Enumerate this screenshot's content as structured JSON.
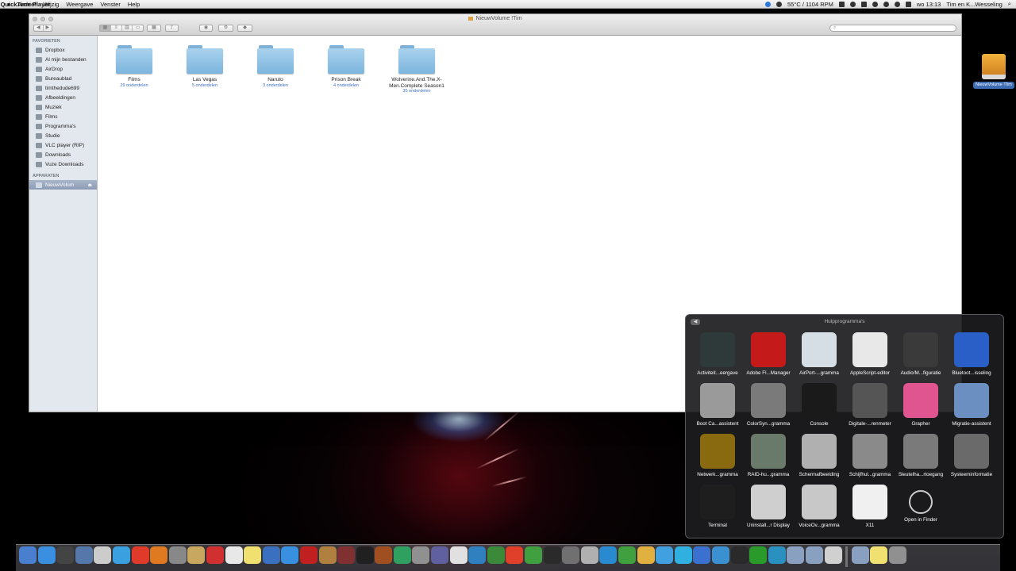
{
  "menubar": {
    "app_name": "QuickTime Player",
    "menus": [
      "Archief",
      "Wijzig",
      "Weergave",
      "Venster",
      "Help"
    ],
    "weather": "55°C / 1104 RPM",
    "clock": "wo 13:13",
    "user": "Tim en K...Wesseling"
  },
  "finder": {
    "title": "NieuwVolume !Tim",
    "search_placeholder": "",
    "sidebar": {
      "favorites_header": "FAVORIETEN",
      "favorites": [
        "Dropbox",
        "Al mijn bestanden",
        "AirDrop",
        "Bureaublad",
        "timthedude699",
        "Afbeeldingen",
        "Muziek",
        "Films",
        "Programma's",
        "Studie",
        "VLC player (RIP)",
        "Downloads",
        "Vuze Downloads"
      ],
      "devices_header": "APPARATEN",
      "devices": [
        "NieuwVolum"
      ]
    },
    "folders": [
      {
        "name": "Films",
        "sub": "29 onderdelen"
      },
      {
        "name": "Las Vegas",
        "sub": "5 onderdelen"
      },
      {
        "name": "Naruto",
        "sub": "3 onderdelen"
      },
      {
        "name": "Prison Break",
        "sub": "4 onderdelen"
      },
      {
        "name": "Wolverine.And.The.X-Men.Complete Season1",
        "sub": "35 onderdelen"
      }
    ]
  },
  "desktop": {
    "drive_label": "NieuwVolume !Tim"
  },
  "stack": {
    "title": "Hulpprogramma's",
    "back_label": "◀",
    "apps": [
      {
        "label": "Activiteit...eergave",
        "icon": "activity-monitor-icon",
        "color": "#2e3a3a"
      },
      {
        "label": "Adobe Fl...Manager",
        "icon": "flash-icon",
        "color": "#c41a1a"
      },
      {
        "label": "AirPort-...gramma",
        "icon": "wifi-icon",
        "color": "#d5dde5"
      },
      {
        "label": "AppleScript-editor",
        "icon": "applescript-icon",
        "color": "#e8e8e8"
      },
      {
        "label": "Audio/M...figuratie",
        "icon": "midi-icon",
        "color": "#3a3a3a"
      },
      {
        "label": "Bluetoot...isseling",
        "icon": "bluetooth-icon",
        "color": "#2a5fc8"
      },
      {
        "label": "Boot Ca...assistent",
        "icon": "bootcamp-icon",
        "color": "#9a9a9a"
      },
      {
        "label": "ColorSyn...gramma",
        "icon": "colorsync-icon",
        "color": "#7a7a7a"
      },
      {
        "label": "Console",
        "icon": "console-icon",
        "color": "#1a1a1a"
      },
      {
        "label": "Digitale-...renmeter",
        "icon": "color-meter-icon",
        "color": "#555555"
      },
      {
        "label": "Grapher",
        "icon": "grapher-icon",
        "color": "#e05590"
      },
      {
        "label": "Migratie-assistent",
        "icon": "migration-icon",
        "color": "#6a8fc0"
      },
      {
        "label": "Netwerk...gramma",
        "icon": "network-utility-icon",
        "color": "#8a6a10"
      },
      {
        "label": "RAID-hu...gramma",
        "icon": "raid-icon",
        "color": "#6a7a6a"
      },
      {
        "label": "Schermafbeelding",
        "icon": "screenshot-icon",
        "color": "#b0b0b0"
      },
      {
        "label": "Schijfhul...gramma",
        "icon": "disk-utility-icon",
        "color": "#8a8a8a"
      },
      {
        "label": "Sleutelha...rtoegang",
        "icon": "keychain-icon",
        "color": "#7a7a7a"
      },
      {
        "label": "Systeeminformatie",
        "icon": "system-info-icon",
        "color": "#6a6a6a"
      },
      {
        "label": "Terminal",
        "icon": "terminal-icon",
        "color": "#1e1e1e"
      },
      {
        "label": "Uninstall...r Display",
        "icon": "uninstaller-icon",
        "color": "#cfcfcf"
      },
      {
        "label": "VoiceOv...gramma",
        "icon": "voiceover-icon",
        "color": "#c8c8c8"
      },
      {
        "label": "X11",
        "icon": "x11-icon",
        "color": "#f0f0f0"
      },
      {
        "label": "Open in Finder",
        "icon": "open-in-finder-icon",
        "color": "transparent"
      }
    ]
  },
  "dock": {
    "colors": [
      "#4a7fd0",
      "#3a8fe0",
      "#444444",
      "#5577aa",
      "#cccccc",
      "#3aa0e0",
      "#e03a2a",
      "#e07a20",
      "#888888",
      "#c8a860",
      "#d03030",
      "#e8e8e8",
      "#f0e070",
      "#3a70c0",
      "#3a90e0",
      "#c02020",
      "#b08040",
      "#803030",
      "#202020",
      "#a05020",
      "#30a060",
      "#909090",
      "#6060a0",
      "#e0e0e0",
      "#3080c0",
      "#3a8a3a",
      "#e0402a",
      "#40a040",
      "#2a2a2a",
      "#707070",
      "#b0b0b0",
      "#2a8ad0",
      "#40a040",
      "#e0b040",
      "#40a0e0",
      "#30b0e0",
      "#3a70d0",
      "#3a90d0",
      "#2a2a2a",
      "#2a9a2a",
      "#2a90c0",
      "#8aa0c0",
      "#8aa0c0",
      "#d0d0d0",
      "#8aa0c0",
      "#f0e070",
      "#909090"
    ]
  }
}
